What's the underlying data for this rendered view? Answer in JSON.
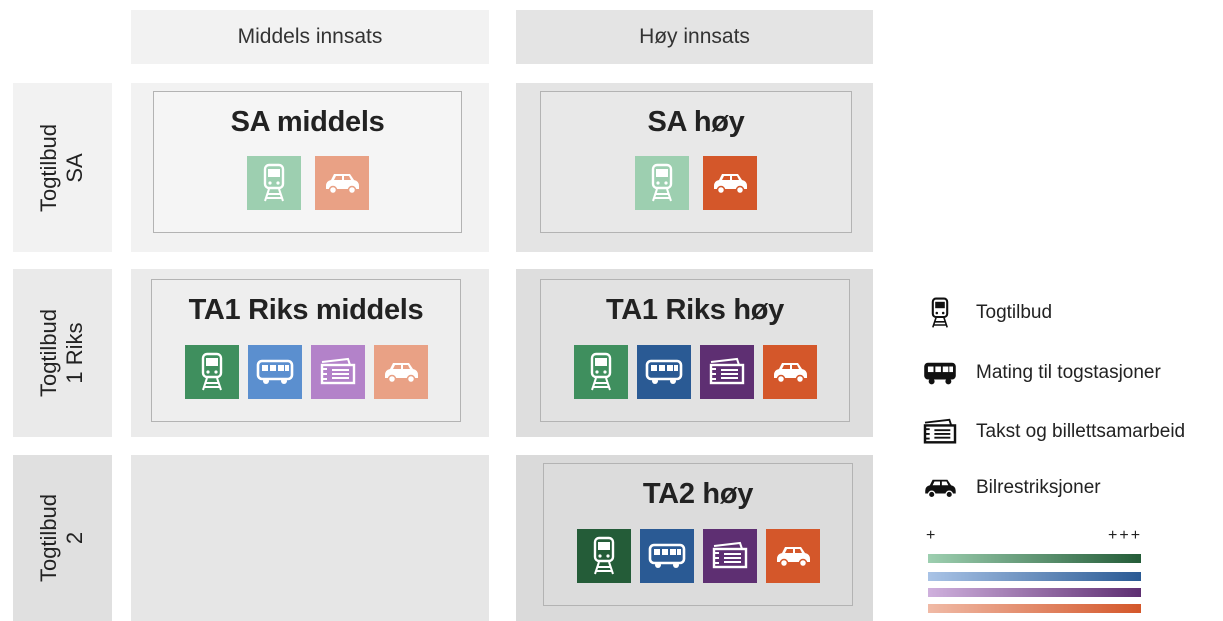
{
  "columns": [
    "Middels innsats",
    "Høy innsats"
  ],
  "rows": [
    {
      "label_line1": "Togtilbud",
      "label_line2": "SA"
    },
    {
      "label_line1": "Togtilbud",
      "label_line2": "1 Riks"
    },
    {
      "label_line1": "Togtilbud",
      "label_line2": "2"
    }
  ],
  "scenarios": {
    "sa_middels": {
      "title": "SA middels"
    },
    "sa_hoy": {
      "title": "SA høy"
    },
    "ta1_middels": {
      "title": "TA1 Riks middels"
    },
    "ta1_hoy": {
      "title": "TA1 Riks høy"
    },
    "ta2_hoy": {
      "title": "TA2 høy"
    }
  },
  "legend": {
    "items": [
      {
        "icon": "train-icon",
        "label": "Togtilbud"
      },
      {
        "icon": "bus-icon",
        "label": "Mating til togstasjoner"
      },
      {
        "icon": "ticket-icon",
        "label": "Takst og billettsamarbeid"
      },
      {
        "icon": "car-icon",
        "label": "Bilrestriksjoner"
      }
    ],
    "scale_low": "+",
    "scale_high": "+++"
  },
  "colors": {
    "train": [
      "#9dcfb0",
      "#3f8f5e",
      "#245c38"
    ],
    "bus": [
      "#5b8fcf",
      "#2a5a94"
    ],
    "ticket": [
      "#b382c9",
      "#5e2f72"
    ],
    "car": [
      "#e9a185",
      "#d4572a"
    ],
    "gradients": [
      [
        "#9dcfb0",
        "#245c38"
      ],
      [
        "#a9c3e6",
        "#2a5a94"
      ],
      [
        "#cfb0dd",
        "#5e2f72"
      ],
      [
        "#f0baa6",
        "#d4572a"
      ]
    ]
  }
}
